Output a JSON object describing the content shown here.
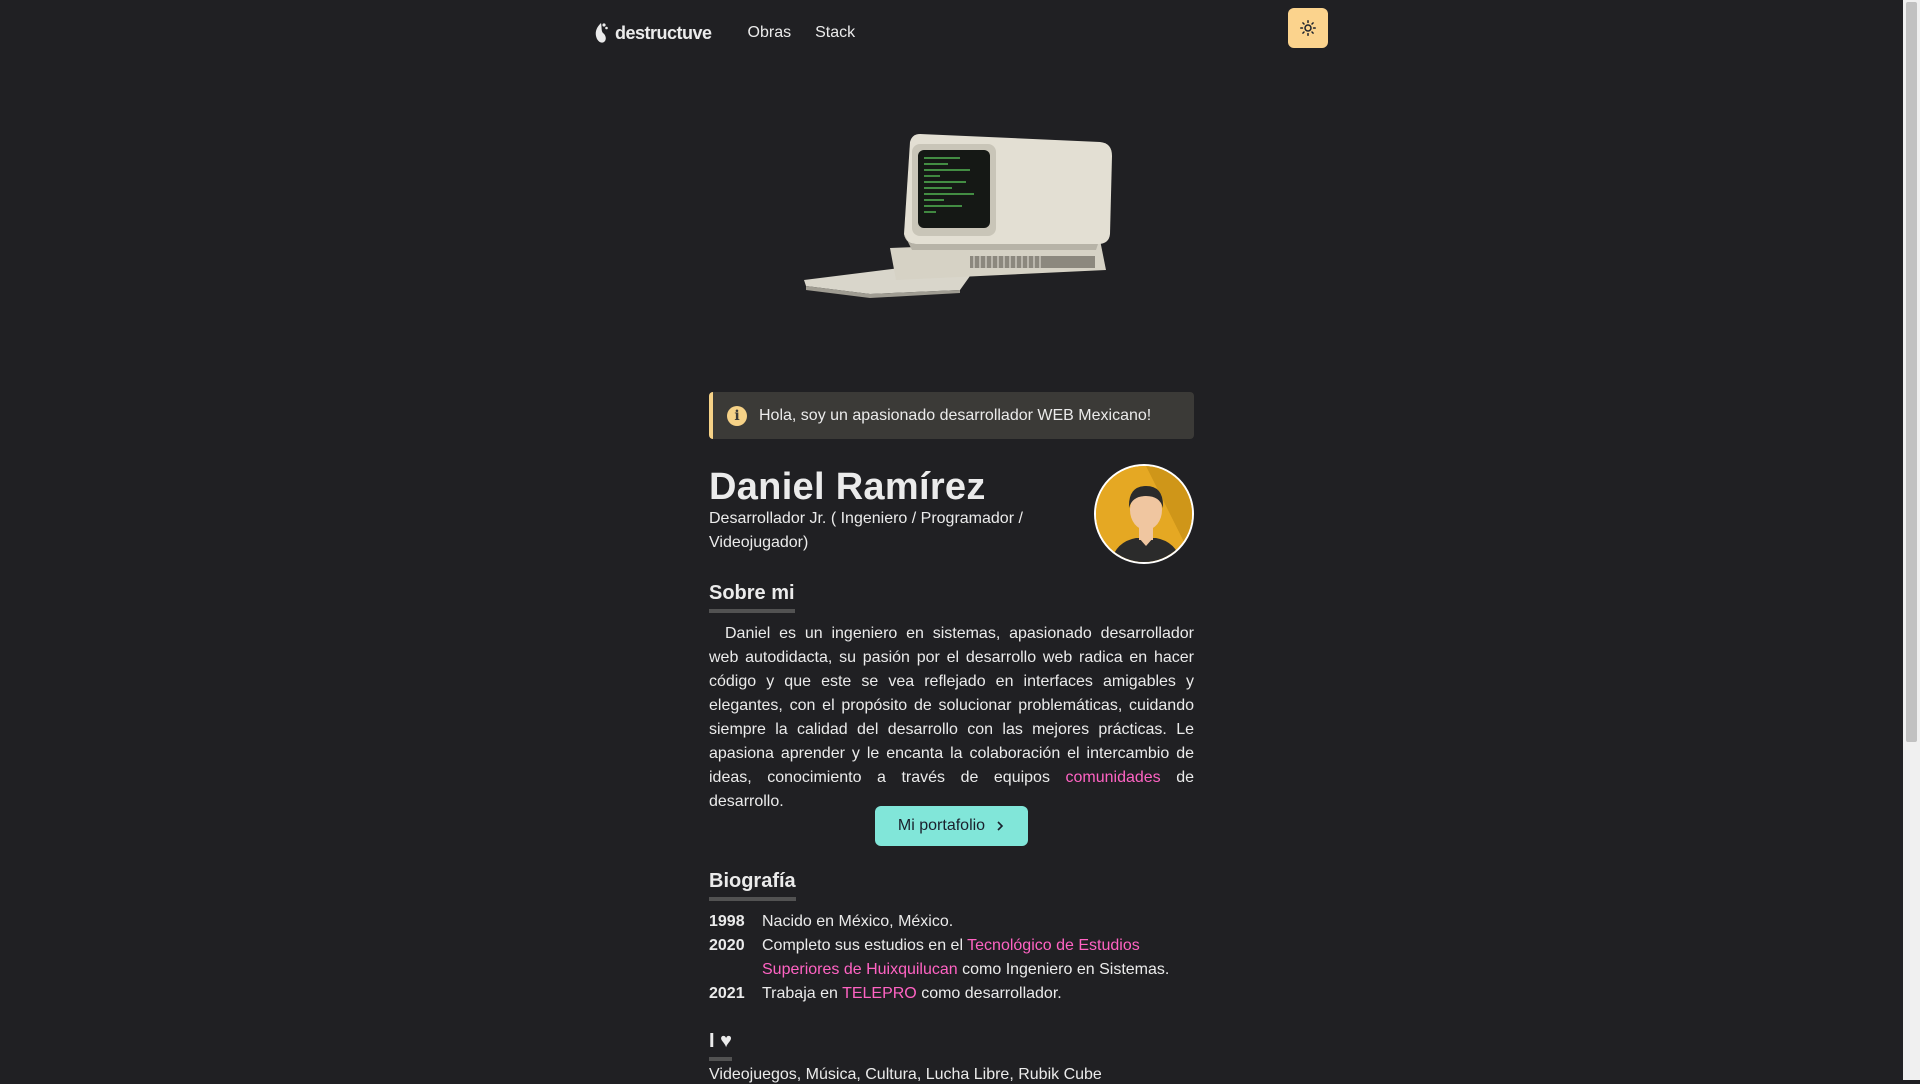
{
  "nav": {
    "logo_text": "destructuve",
    "links": [
      "Obras",
      "Stack"
    ],
    "theme_toggle_icon": "sun-icon"
  },
  "alert": {
    "icon": "info-icon",
    "text": "Hola, soy un apasionado desarrollador WEB Mexicano!"
  },
  "profile": {
    "name": "Daniel Ramírez",
    "role": "Desarrollador Jr. ( Ingeniero / Programador / Videojugador)"
  },
  "about": {
    "title": "Sobre mi",
    "text_before": "Daniel es un ingeniero en sistemas, apasionado desarrollador web autodidacta, su pasión por el desarrollo web radica en hacer código y que este se vea reflejado en interfaces amigables y elegantes, con el propósito de solucionar problemáticas, cuidando siempre la calidad del desarrollo con las mejores prácticas. Le apasiona aprender y le encanta la colaboración el intercambio de ideas, conocimiento a través de equipos ",
    "link_text": "comunidades",
    "text_after": " de desarrollo.",
    "button_label": "Mi portafolio"
  },
  "biography": {
    "title": "Biografía",
    "entries": [
      {
        "year": "1998",
        "before": "Nacido en México, México.",
        "link": "",
        "after": ""
      },
      {
        "year": "2020",
        "before": "Completo sus estudios en el ",
        "link": "Tecnológico de Estudios Superiores de Huixquilucan",
        "after": " como Ingeniero en Sistemas."
      },
      {
        "year": "2021",
        "before": "Trabaja en ",
        "link": "TELEPRO",
        "after": " como desarrollador."
      }
    ]
  },
  "love": {
    "title": "I ♥",
    "partial_text": "Videojuegos, Música, Cultura, Lucha Libre, Rubik Cube"
  },
  "colors": {
    "background": "#202023",
    "accent_pink": "#ff63c3",
    "button_teal": "#81e6d9",
    "toggle_yellow": "#fbd38d"
  }
}
